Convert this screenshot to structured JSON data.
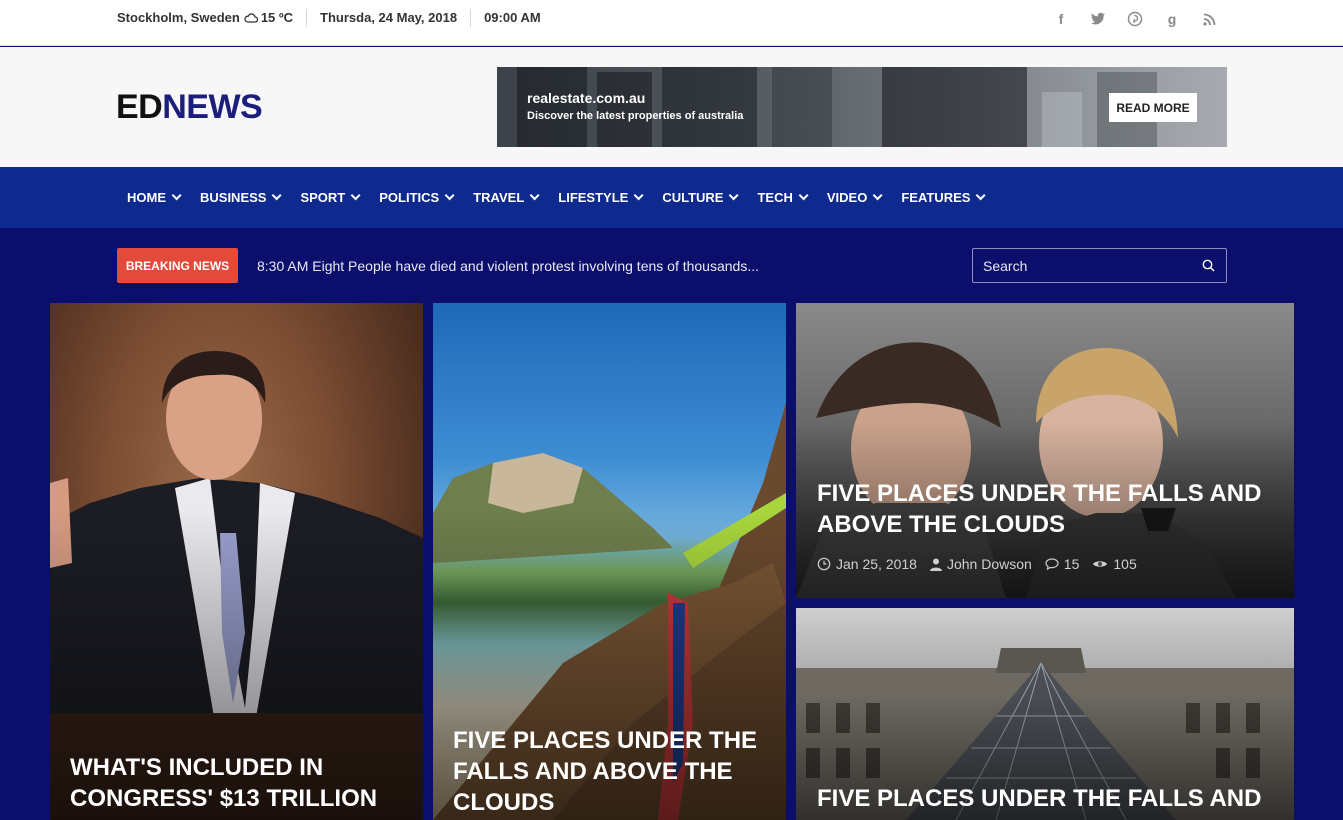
{
  "topbar": {
    "location": "Stockholm, Sweden",
    "temperature": "15 ºC",
    "date": "Thursda, 24 May, 2018",
    "time": "09:00 AM",
    "social": [
      "facebook-icon",
      "twitter-icon",
      "pinterest-icon",
      "google-plus-icon",
      "rss-icon"
    ]
  },
  "logo": {
    "part1": "ED",
    "part2": "NEWS"
  },
  "ad": {
    "brand": "realestate.com.au",
    "tagline": "Discover the latest properties of australia",
    "button": "READ MORE"
  },
  "nav": {
    "items": [
      "HOME",
      "BUSINESS",
      "SPORT",
      "POLITICS",
      "TRAVEL",
      "LIFESTYLE",
      "CULTURE",
      "TECH",
      "VIDEO",
      "FEATURES"
    ]
  },
  "breaking": {
    "label": "BREAKING NEWS",
    "text": "8:30 AM Eight People have died and violent protest involving tens of thousands..."
  },
  "search": {
    "placeholder": "Search"
  },
  "cards": [
    {
      "title": "WHAT'S INCLUDED IN CONGRESS' $13 TRILLION"
    },
    {
      "title": "FIVE PLACES UNDER THE FALLS AND ABOVE THE CLOUDS"
    },
    {
      "title": "FIVE PLACES UNDER THE FALLS AND ABOVE THE CLOUDS",
      "date": "Jan 25, 2018",
      "author": "John Dowson",
      "comments": "15",
      "views": "105"
    },
    {
      "title": "FIVE PLACES UNDER THE FALLS AND"
    }
  ],
  "colors": {
    "nav": "#0e2a8f",
    "page": "#0b0f6b",
    "breaking": "#e34a3c",
    "logo_accent": "#1b1e7a"
  }
}
